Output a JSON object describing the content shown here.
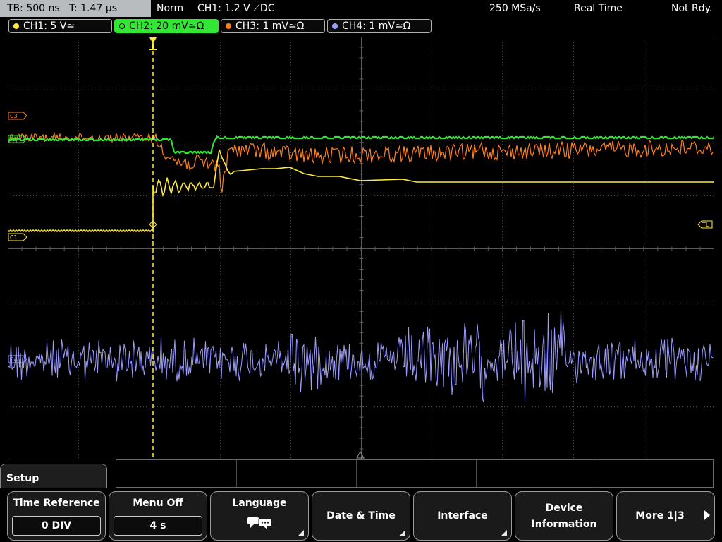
{
  "status": {
    "timebase": "TB: 500 ns   T: 1.47 µs",
    "mode": "Norm",
    "trigger": "CH1: 1.2 V ⟋DC",
    "sample_rate": "250 MSa/s",
    "acq_mode": "Real Time",
    "state": "Not Rdy."
  },
  "channels": [
    {
      "label": "CH1: 5 V≃",
      "color": "#ffeb3b"
    },
    {
      "label": "CH2: 20 mV≃Ω",
      "color": "#33e633"
    },
    {
      "label": "CH3: 1 mV≃Ω",
      "color": "#ff8020"
    },
    {
      "label": "CH4: 1 mV≃Ω",
      "color": "#9b9bff"
    }
  ],
  "markers": {
    "c3": "C3",
    "c1": "C1",
    "c2": "C2",
    "c4": "C4",
    "tl": "TL"
  },
  "menu": {
    "title": "Setup",
    "softkeys": [
      {
        "label": "Time Reference",
        "value": "0 DIV"
      },
      {
        "label": "Menu Off",
        "value": "4 s"
      },
      {
        "label": "Language",
        "icon": "speech-bubbles-icon"
      },
      {
        "label": "Date & Time"
      },
      {
        "label": "Interface"
      },
      {
        "label": "Device",
        "label2": "Information"
      },
      {
        "label": "More 1|3"
      }
    ]
  },
  "colors": {
    "grid": "#4b4b4b",
    "trigger_line": "#ffeb3b"
  }
}
